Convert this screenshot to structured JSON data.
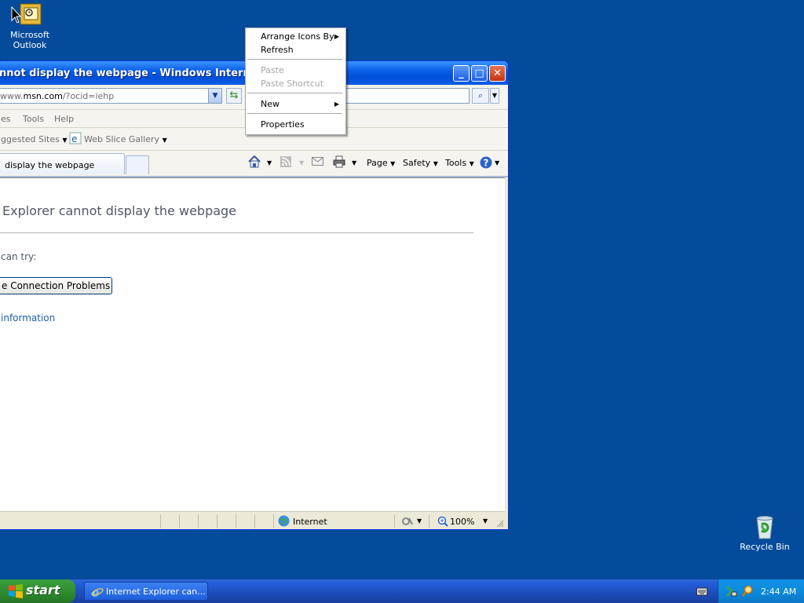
{
  "desktop": {
    "icons": [
      {
        "label_line1": "Microsoft",
        "label_line2": "Outlook",
        "icon": "outlook-icon"
      },
      {
        "label_line1": "Recycle Bin",
        "icon": "recycle-bin-icon"
      }
    ]
  },
  "ie": {
    "title": "nnot display the webpage - Windows Internet Explo",
    "address_domain": "msn.com",
    "address_prefix": "www.",
    "address_suffix": "/?ocid=iehp",
    "menu": [
      "es",
      "Tools",
      "Help"
    ],
    "favorites": [
      "ggested Sites",
      "Web Slice Gallery"
    ],
    "tab_label": "display the webpage",
    "commands": {
      "page": "Page",
      "safety": "Safety",
      "tools": "Tools"
    },
    "content": {
      "title": "Explorer cannot display the webpage",
      "try_text": "can try:",
      "diagnose_button": "e Connection Problems",
      "more_info": "information"
    },
    "status": {
      "zone": "Internet",
      "zoom": "100%"
    }
  },
  "context_menu": {
    "items": [
      {
        "label": "Arrange Icons By",
        "submenu": true,
        "disabled": false
      },
      {
        "label": "Refresh",
        "submenu": false,
        "disabled": false
      },
      {
        "label": "Paste",
        "submenu": false,
        "disabled": true
      },
      {
        "label": "Paste Shortcut",
        "submenu": false,
        "disabled": true
      },
      {
        "label": "New",
        "submenu": true,
        "disabled": false
      },
      {
        "label": "Properties",
        "submenu": false,
        "disabled": false
      }
    ]
  },
  "taskbar": {
    "start_label": "start",
    "task_label": "Internet Explorer can...",
    "clock": "2:44 AM"
  },
  "colors": {
    "desktop": "#054b9b",
    "title_bar": "#0a5ee8",
    "taskbar": "#245edb",
    "start": "#2d8a2d"
  }
}
